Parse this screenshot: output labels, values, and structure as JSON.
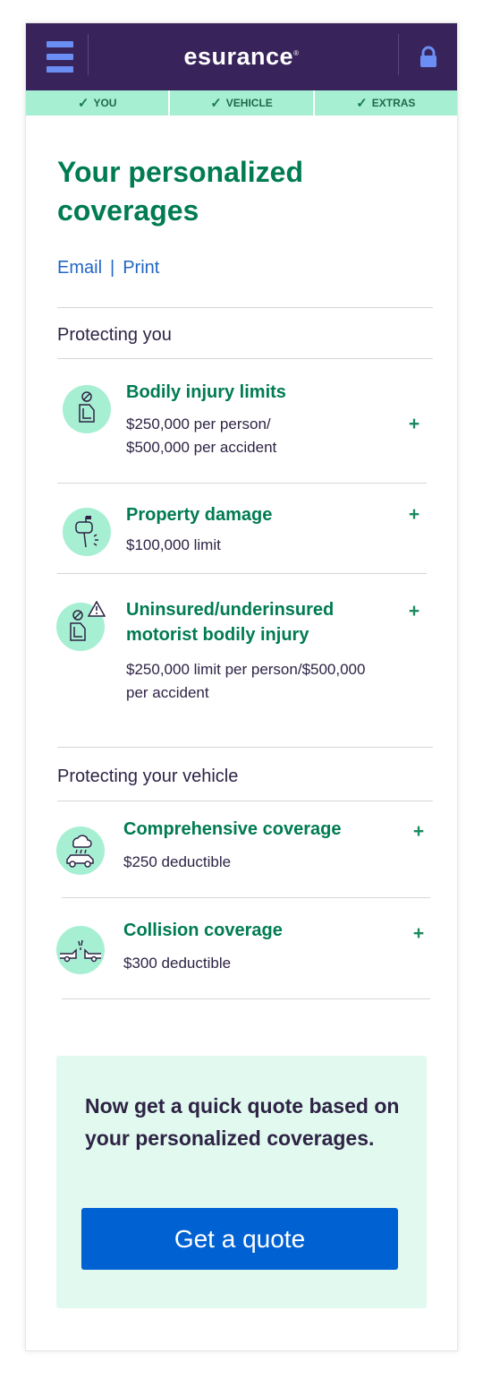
{
  "header": {
    "logo_text": "esurance",
    "logo_mark": "®",
    "menu_icon": "hamburger-menu-icon",
    "lock_icon": "lock-icon",
    "background": "#38245a",
    "accent": "#6b8ef5"
  },
  "progress_steps": [
    {
      "label": "YOU",
      "status": "complete"
    },
    {
      "label": "VEHICLE",
      "status": "complete"
    },
    {
      "label": "EXTRAS",
      "status": "complete"
    }
  ],
  "page": {
    "title": "Your personalized coverages",
    "email_link": "Email",
    "link_separator": "|",
    "print_link": "Print"
  },
  "sections": [
    {
      "title": "Protecting you",
      "coverages": [
        {
          "name": "Bodily injury limits",
          "detail_line1": "$250,000 per person/",
          "detail_line2": "$500,000 per accident",
          "icon": "bodily-injury-icon",
          "expand": "+"
        },
        {
          "name": "Property damage",
          "detail_line1": "$100,000 limit",
          "icon": "property-damage-mailbox-icon",
          "expand": "+"
        },
        {
          "name_line1": "Uninsured/underinsured",
          "name_line2": "motorist bodily injury",
          "detail_line1": "$250,000 limit per person/$500,000",
          "detail_line2": "per accident",
          "icon": "uninsured-motorist-icon",
          "expand": "+"
        }
      ]
    },
    {
      "title": "Protecting your vehicle",
      "coverages": [
        {
          "name": "Comprehensive coverage",
          "detail_line1": "$250 deductible",
          "icon": "comprehensive-storm-car-icon",
          "expand": "+"
        },
        {
          "name": "Collision coverage",
          "detail_line1": "$300 deductible",
          "icon": "collision-cars-icon",
          "expand": "+"
        }
      ]
    }
  ],
  "cta": {
    "text": "Now get a quick quote based on your personalized coverages.",
    "button_label": "Get a quote",
    "button_color": "#0061d2",
    "background": "#e1f9ef"
  },
  "colors": {
    "title_green": "#007b52",
    "step_mint": "#a7efd3",
    "link_blue": "#2166c4",
    "text_dark": "#2e2345"
  }
}
